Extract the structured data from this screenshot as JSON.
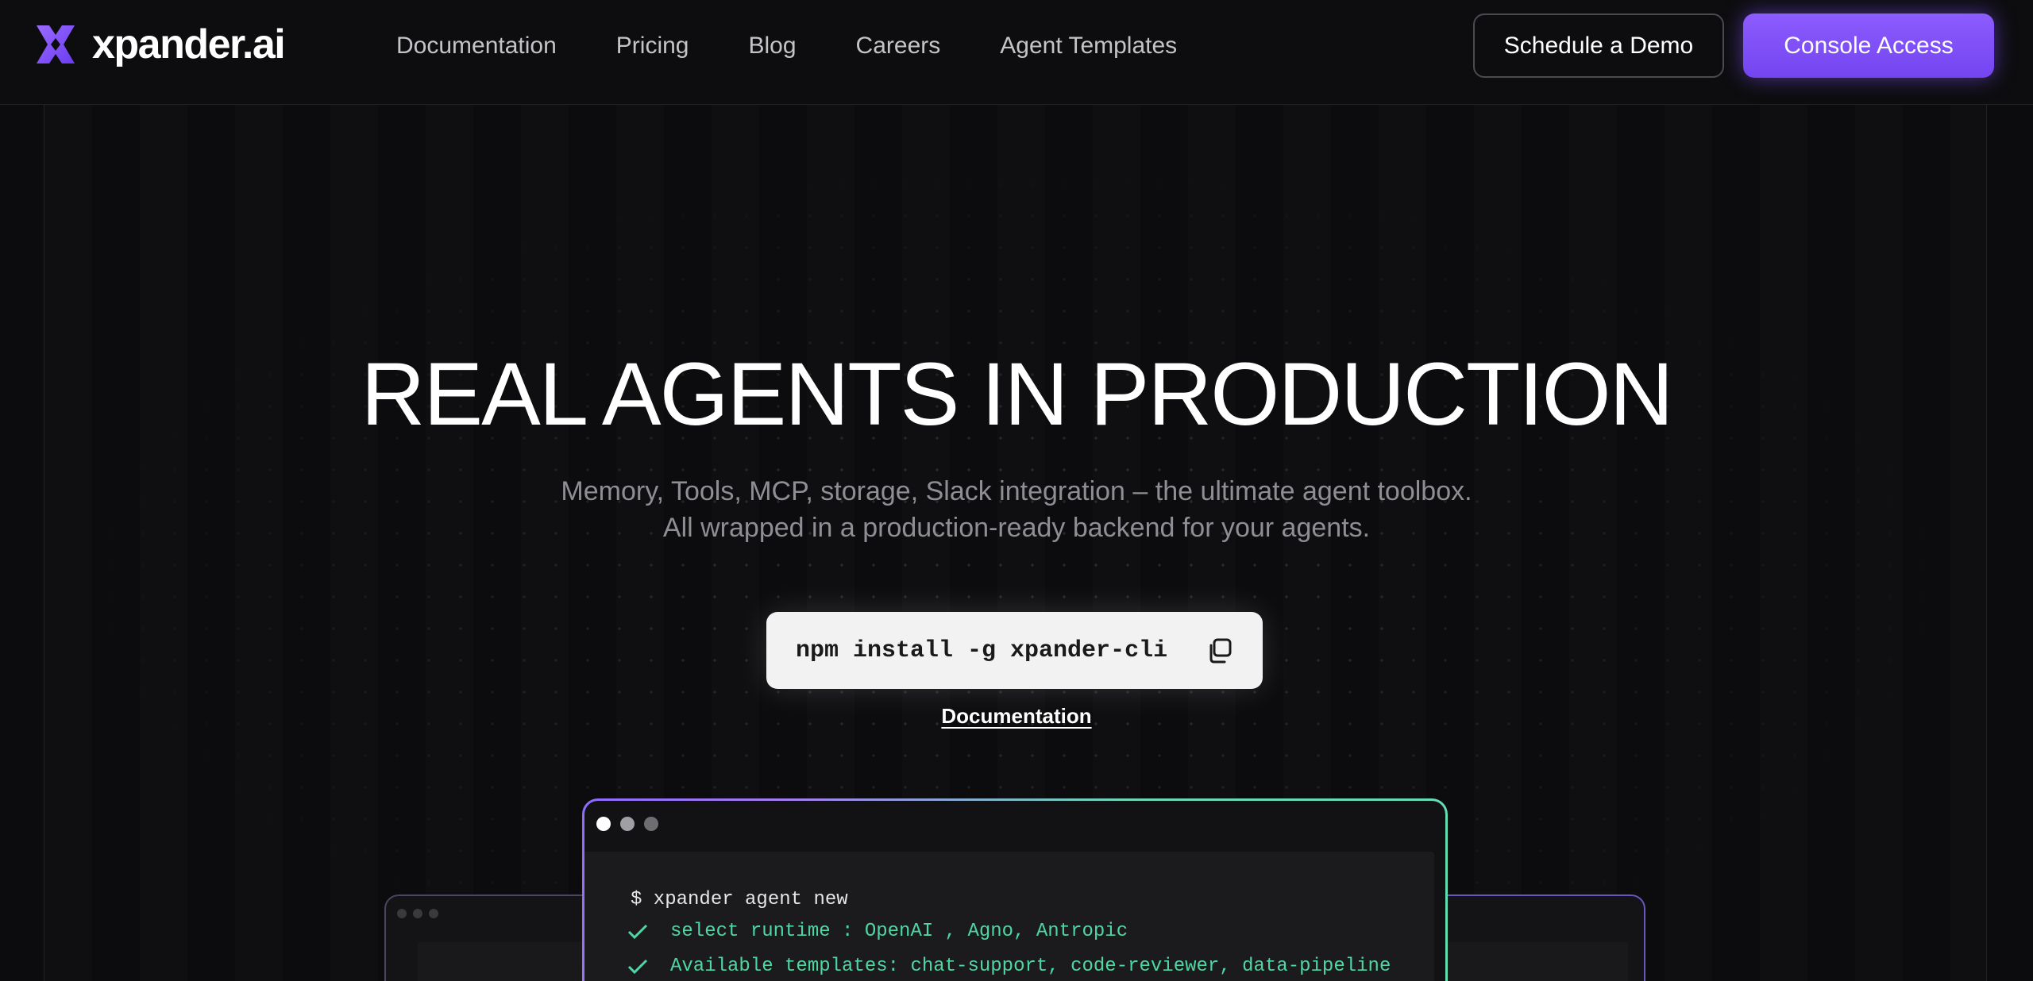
{
  "brand": {
    "name": "xpander.ai",
    "accent": "#7c4dff"
  },
  "nav": {
    "items": [
      {
        "label": "Documentation"
      },
      {
        "label": "Pricing"
      },
      {
        "label": "Blog"
      },
      {
        "label": "Careers"
      },
      {
        "label": "Agent Templates"
      }
    ]
  },
  "header_actions": {
    "demo_label": "Schedule a Demo",
    "console_label": "Console Access"
  },
  "hero": {
    "title": "REAL AGENTS IN PRODUCTION",
    "subtitle_line1": "Memory, Tools, MCP, storage, Slack integration – the ultimate agent toolbox.",
    "subtitle_line2": "All wrapped in a production-ready backend for your agents.",
    "install_command": "npm install -g xpander-cli",
    "docs_link": "Documentation"
  },
  "terminal": {
    "prompt": "$ xpander agent new",
    "lines": [
      "select runtime : OpenAI , Agno, Antropic",
      "Available templates: chat-support, code-reviewer, data-pipeline"
    ],
    "dot_colors": [
      "#ffffff",
      "#a0a0a4",
      "#6e6e72"
    ],
    "success_color": "#4fd6a3"
  }
}
